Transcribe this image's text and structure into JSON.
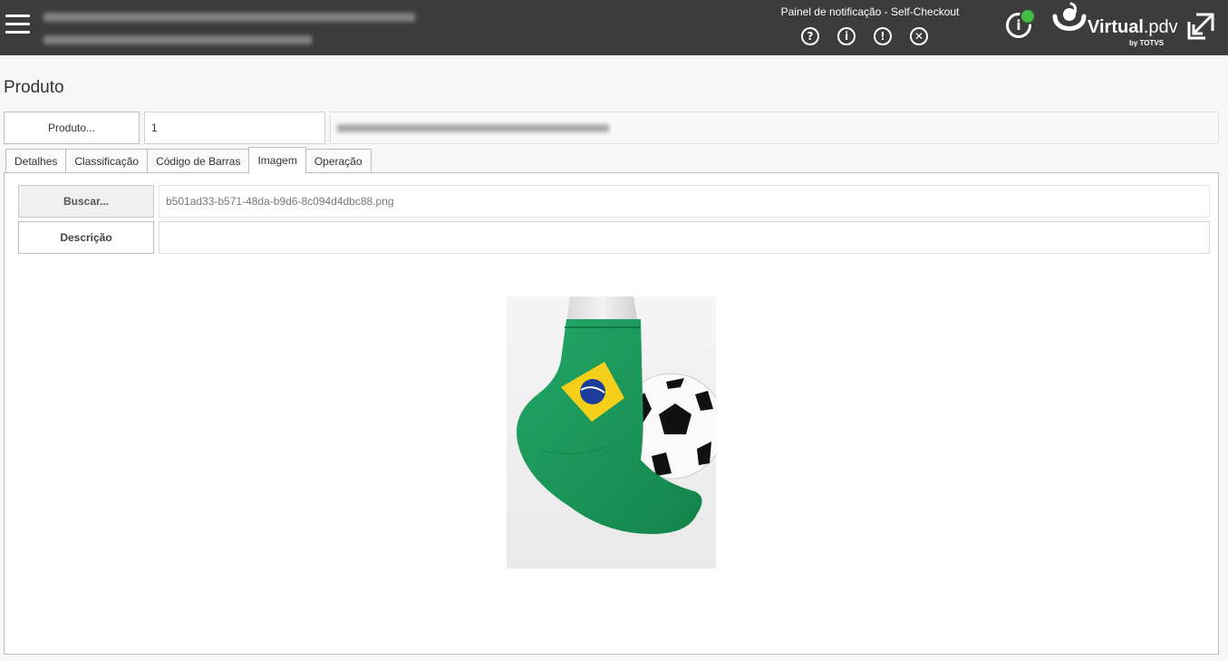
{
  "header": {
    "info_line1": "VIRTUAL AGE - DESENVOLVIMENTO CLIMOBI - 18/12/2020",
    "info_line2": "0.00.123.0000.00 - PDV - TOTVS-0024(1) - PE",
    "notification_title": "Painel de notificação - Self-Checkout",
    "notification_icons": [
      "help-icon",
      "info-icon",
      "warning-icon",
      "close-circle-icon"
    ],
    "status_color": "#44bb44",
    "logo_text_bold": "Virtual",
    "logo_text_light": ".pdv",
    "logo_by": "by TOTVS"
  },
  "page": {
    "title": "Produto"
  },
  "product": {
    "button_label": "Produto...",
    "code_value": "1",
    "description_value": "ARGOLA PARA MEIA BRASIL, BRASIL 1"
  },
  "tabs": [
    {
      "label": "Detalhes",
      "active": false
    },
    {
      "label": "Classificação",
      "active": false
    },
    {
      "label": "Código de Barras",
      "active": false
    },
    {
      "label": "Imagem",
      "active": true
    },
    {
      "label": "Operação",
      "active": false
    }
  ],
  "image_tab": {
    "search_button_label": "Buscar...",
    "file_name": "b501ad33-b571-48da-b9d6-8c094d4dbc88.png",
    "description_button_label": "Descrição",
    "description_value": ""
  },
  "colors": {
    "header_bg": "#3c3c3c",
    "sock_green": "#1e9e5c"
  }
}
